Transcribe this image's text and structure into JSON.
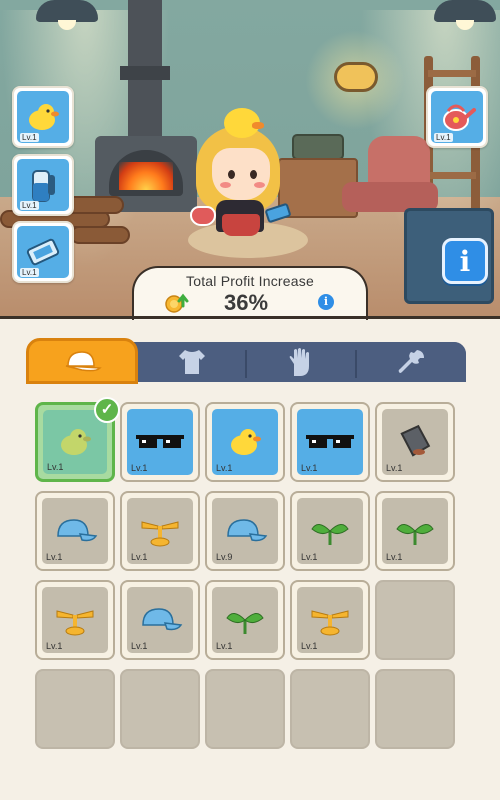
{
  "equipped": {
    "left": [
      {
        "icon": "duck-hat-icon",
        "level": "Lv.1"
      },
      {
        "icon": "water-bottle-icon",
        "level": "Lv.1"
      },
      {
        "icon": "phone-icon",
        "level": "Lv.1"
      }
    ],
    "right": [
      {
        "icon": "watering-can-icon",
        "level": "Lv.1"
      }
    ]
  },
  "profit": {
    "title": "Total Profit Increase",
    "value": "36%"
  },
  "tabs": [
    {
      "name": "hat",
      "icon": "cap-icon",
      "active": true
    },
    {
      "name": "clothes",
      "icon": "shirt-icon",
      "active": false
    },
    {
      "name": "gloves",
      "icon": "glove-icon",
      "active": false
    },
    {
      "name": "tools",
      "icon": "wrench-icon",
      "active": false
    }
  ],
  "inventory": [
    {
      "item": "duck-hat-icon",
      "level": "Lv.1",
      "rarity": "green",
      "equipped": true
    },
    {
      "item": "sunglasses-icon",
      "level": "Lv.1",
      "rarity": "blue"
    },
    {
      "item": "duck-hat-icon",
      "level": "Lv.1",
      "rarity": "blue"
    },
    {
      "item": "sunglasses-icon",
      "level": "Lv.1",
      "rarity": "blue"
    },
    {
      "item": "bucket-hat-icon",
      "level": "Lv.1",
      "rarity": "gray"
    },
    {
      "item": "cap-icon",
      "level": "Lv.1",
      "rarity": "gray"
    },
    {
      "item": "propeller-icon",
      "level": "Lv.1",
      "rarity": "gray"
    },
    {
      "item": "cap-icon",
      "level": "Lv.9",
      "rarity": "gray"
    },
    {
      "item": "sprout-icon",
      "level": "Lv.1",
      "rarity": "gray"
    },
    {
      "item": "sprout-icon",
      "level": "Lv.1",
      "rarity": "gray"
    },
    {
      "item": "propeller-icon",
      "level": "Lv.1",
      "rarity": "gray"
    },
    {
      "item": "cap-icon",
      "level": "Lv.1",
      "rarity": "gray"
    },
    {
      "item": "sprout-icon",
      "level": "Lv.1",
      "rarity": "gray"
    },
    {
      "item": "propeller-icon",
      "level": "Lv.1",
      "rarity": "gray"
    }
  ],
  "colors": {
    "active_tab": "#f7a21d",
    "inactive_tab": "#4c5e80",
    "blue_rarity": "#55aee6",
    "green_rarity": "#7bc7a5",
    "equipped_check": "#5fb54a"
  }
}
